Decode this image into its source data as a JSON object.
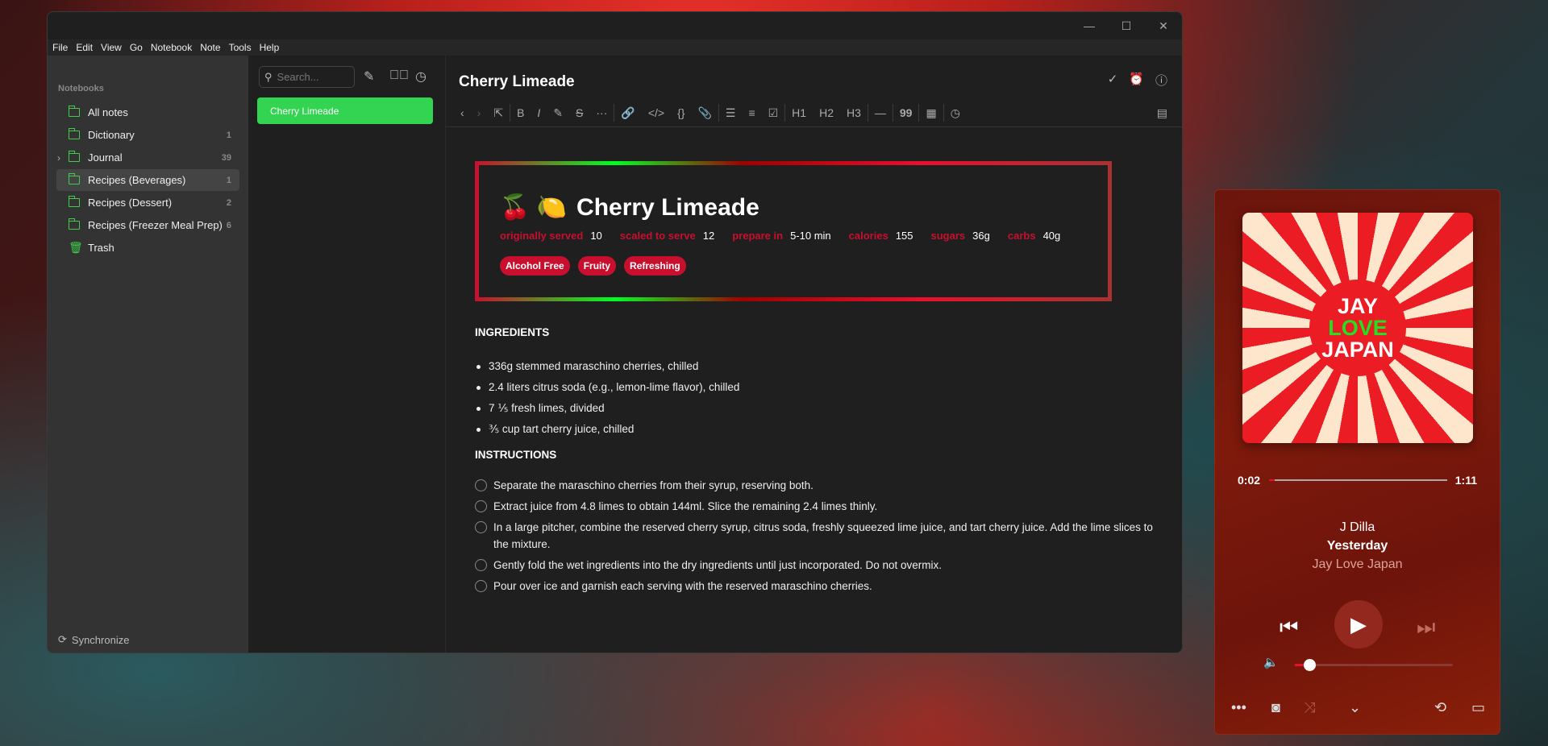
{
  "window": {
    "controls": [
      "—",
      "☐",
      "✕"
    ]
  },
  "menu": [
    "File",
    "Edit",
    "View",
    "Go",
    "Notebook",
    "Note",
    "Tools",
    "Help"
  ],
  "sidebar": {
    "heading": "Notebooks",
    "items": [
      {
        "label": "All notes",
        "count": ""
      },
      {
        "label": "Dictionary",
        "count": "1"
      },
      {
        "label": "Journal",
        "count": "39"
      },
      {
        "label": "Recipes (Beverages)",
        "count": "1"
      },
      {
        "label": "Recipes (Dessert)",
        "count": "2"
      },
      {
        "label": "Recipes (Freezer Meal Prep)",
        "count": "6"
      },
      {
        "label": "Trash",
        "count": ""
      }
    ],
    "sync": "Synchronize"
  },
  "notelist": {
    "search_placeholder": "Search...",
    "notes": [
      "Cherry Limeade"
    ]
  },
  "editor": {
    "title": "Cherry Limeade",
    "toolbar": [
      "‹",
      "›",
      "⇱",
      "B",
      "I",
      "✎",
      "S",
      "···",
      "🔗",
      "</>",
      "{}",
      "📎",
      "☰",
      "≡",
      "☑",
      "H1",
      "H2",
      "H3",
      "—",
      "99",
      "▦",
      "◷"
    ],
    "recipe": {
      "emoji": "🍒 🍋",
      "title": "Cherry Limeade",
      "meta": [
        {
          "k": "originally served",
          "v": "10"
        },
        {
          "k": "scaled to serve",
          "v": "12"
        },
        {
          "k": "prepare in",
          "v": "5-10 min"
        },
        {
          "k": "calories",
          "v": "155"
        },
        {
          "k": "sugars",
          "v": "36g"
        },
        {
          "k": "carbs",
          "v": "40g"
        }
      ],
      "tags": [
        "Alcohol Free",
        "Fruity",
        "Refreshing"
      ]
    },
    "ingredients_heading": "INGREDIENTS",
    "ingredients": [
      "336g stemmed maraschino cherries, chilled",
      "2.4 liters citrus soda (e.g., lemon-lime flavor), chilled",
      "7 ⅕ fresh limes, divided",
      "⅗ cup tart cherry juice, chilled"
    ],
    "instructions_heading": "INSTRUCTIONS",
    "instructions": [
      "Separate the maraschino cherries from their syrup, reserving both.",
      "Extract juice from 4.8 limes to obtain 144ml. Slice the remaining 2.4 limes thinly.",
      "In a large pitcher, combine the reserved cherry syrup, citrus soda, freshly squeezed lime juice, and tart cherry juice. Add the lime slices to the mixture.",
      "Gently fold the wet ingredients into the dry ingredients until just incorporated. Do not overmix.",
      "Pour over ice and garnish each serving with the reserved maraschino cherries."
    ]
  },
  "player": {
    "art_text": [
      "JAY",
      "LOVE",
      "JAPAN"
    ],
    "elapsed": "0:02",
    "duration": "1:11",
    "progress": 0.03,
    "artist": "J Dilla",
    "track": "Yesterday",
    "album": "Jay Love Japan",
    "volume": 0.09
  }
}
